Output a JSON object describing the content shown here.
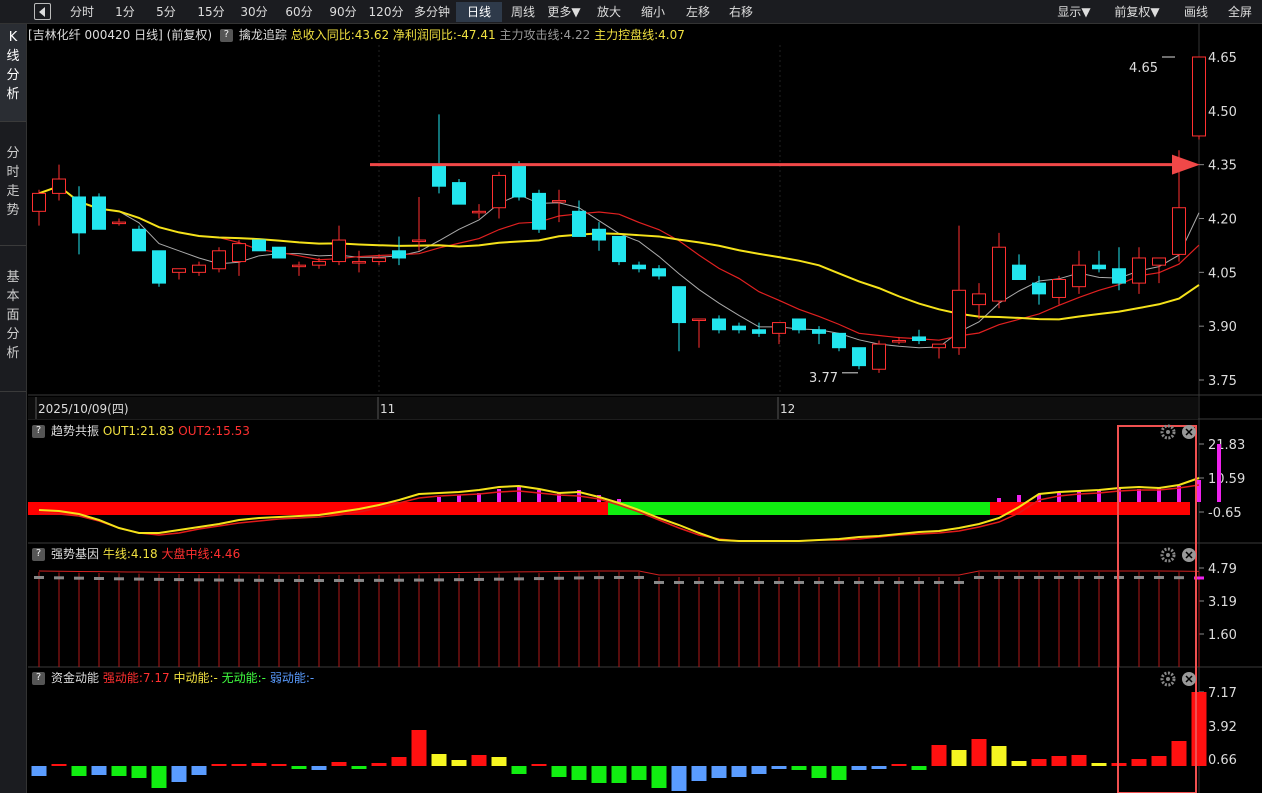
{
  "toolbar": {
    "buttons": [
      "分时",
      "1分",
      "5分",
      "15分",
      "30分",
      "60分",
      "90分",
      "120分",
      "多分钟",
      "日线",
      "周线",
      "更多▼",
      "放大",
      "缩小",
      "左移",
      "右移"
    ],
    "active": "日线",
    "right_buttons": [
      "显示▼",
      "前复权▼",
      "画线",
      "全屏"
    ]
  },
  "sidebar": {
    "tabs": [
      {
        "label": "K线分析",
        "chars": [
          "K",
          "线",
          "分",
          "析"
        ]
      },
      {
        "label": "分时走势",
        "chars": [
          "分",
          "时",
          "走",
          "势"
        ]
      },
      {
        "label": "基本面分析",
        "chars": [
          "基",
          "本",
          "面",
          "分",
          "析"
        ]
      }
    ]
  },
  "main_chart": {
    "stock": "[吉林化纤 000420 日线]",
    "adjust": "(前复权)",
    "indicator_name": "擒龙追踪",
    "revenue_label": "总收入同比:43.62",
    "profit_label": "净利润同比:-47.41",
    "attack_label": "主力攻击线:4.22",
    "control_label": "主力控盘线:4.07",
    "y_ticks": [
      "4.65",
      "4.50",
      "4.35",
      "4.20",
      "4.05",
      "3.90",
      "3.75"
    ],
    "high_label": "4.65",
    "low_label": "3.77",
    "date_labels": [
      "2025/10/09(四)",
      "11",
      "12"
    ],
    "colors": {
      "up": "#ff3030",
      "down": "#22e5ee",
      "ma_yellow": "#f5e21a",
      "ma_red": "#e02020",
      "ma_gray": "#aaaaaa",
      "arrow": "#f04848"
    }
  },
  "panel1": {
    "name": "趋势共振",
    "out1": "OUT1:21.83",
    "out2": "OUT2:15.53",
    "y_ticks": [
      "21.83",
      "10.59",
      "-0.65"
    ]
  },
  "panel2": {
    "name": "强势基因",
    "bull": "牛线:4.18",
    "market": "大盘中线:4.46",
    "y_ticks": [
      "4.79",
      "3.19",
      "1.60"
    ]
  },
  "panel3": {
    "name": "资金动能",
    "strong": "强动能:7.17",
    "mid": "中动能:-",
    "none": "无动能:-",
    "weak": "弱动能:-",
    "y_ticks": [
      "7.17",
      "3.92",
      "0.66"
    ]
  },
  "chart_data": {
    "type": "candlestick",
    "series_ohlc": [
      [
        4.22,
        4.28,
        4.18,
        4.27
      ],
      [
        4.27,
        4.35,
        4.25,
        4.31
      ],
      [
        4.26,
        4.29,
        4.1,
        4.16
      ],
      [
        4.26,
        4.27,
        4.17,
        4.17
      ],
      [
        4.19,
        4.2,
        4.18,
        4.19
      ],
      [
        4.17,
        4.18,
        4.11,
        4.11
      ],
      [
        4.11,
        4.11,
        4.01,
        4.02
      ],
      [
        4.05,
        4.06,
        4.03,
        4.06
      ],
      [
        4.05,
        4.08,
        4.04,
        4.07
      ],
      [
        4.06,
        4.12,
        4.05,
        4.11
      ],
      [
        4.08,
        4.14,
        4.04,
        4.13
      ],
      [
        4.14,
        4.14,
        4.11,
        4.11
      ],
      [
        4.12,
        4.12,
        4.09,
        4.09
      ],
      [
        4.07,
        4.08,
        4.04,
        4.07
      ],
      [
        4.07,
        4.09,
        4.06,
        4.08
      ],
      [
        4.08,
        4.18,
        4.07,
        4.14
      ],
      [
        4.08,
        4.11,
        4.05,
        4.08
      ],
      [
        4.08,
        4.1,
        4.07,
        4.09
      ],
      [
        4.11,
        4.15,
        4.07,
        4.09
      ],
      [
        4.14,
        4.26,
        4.11,
        4.14
      ],
      [
        4.35,
        4.49,
        4.27,
        4.29
      ],
      [
        4.3,
        4.31,
        4.24,
        4.24
      ],
      [
        4.22,
        4.24,
        4.2,
        4.22
      ],
      [
        4.23,
        4.33,
        4.2,
        4.32
      ],
      [
        4.35,
        4.36,
        4.25,
        4.26
      ],
      [
        4.27,
        4.28,
        4.16,
        4.17
      ],
      [
        4.25,
        4.28,
        4.19,
        4.25
      ],
      [
        4.22,
        4.25,
        4.15,
        4.15
      ],
      [
        4.17,
        4.19,
        4.11,
        4.14
      ],
      [
        4.15,
        4.15,
        4.07,
        4.08
      ],
      [
        4.07,
        4.08,
        4.05,
        4.06
      ],
      [
        4.06,
        4.07,
        4.03,
        4.04
      ],
      [
        4.01,
        4.01,
        3.83,
        3.91
      ],
      [
        3.92,
        3.92,
        3.84,
        3.92
      ],
      [
        3.92,
        3.93,
        3.88,
        3.89
      ],
      [
        3.9,
        3.91,
        3.88,
        3.89
      ],
      [
        3.89,
        3.91,
        3.87,
        3.88
      ],
      [
        3.88,
        3.91,
        3.85,
        3.91
      ],
      [
        3.92,
        3.92,
        3.88,
        3.89
      ],
      [
        3.89,
        3.9,
        3.85,
        3.88
      ],
      [
        3.88,
        3.88,
        3.83,
        3.84
      ],
      [
        3.84,
        3.84,
        3.78,
        3.79
      ],
      [
        3.78,
        3.86,
        3.77,
        3.85
      ],
      [
        3.86,
        3.87,
        3.85,
        3.86
      ],
      [
        3.87,
        3.89,
        3.85,
        3.86
      ],
      [
        3.84,
        3.85,
        3.81,
        3.85
      ],
      [
        3.84,
        4.18,
        3.82,
        4.0
      ],
      [
        3.96,
        4.02,
        3.92,
        3.99
      ],
      [
        3.97,
        4.16,
        3.95,
        4.12
      ],
      [
        4.07,
        4.1,
        4.03,
        4.03
      ],
      [
        4.02,
        4.04,
        3.96,
        3.99
      ],
      [
        3.98,
        4.04,
        3.96,
        4.03
      ],
      [
        4.01,
        4.11,
        3.99,
        4.07
      ],
      [
        4.07,
        4.11,
        4.05,
        4.06
      ],
      [
        4.06,
        4.12,
        4.0,
        4.02
      ],
      [
        4.02,
        4.12,
        3.99,
        4.09
      ],
      [
        4.07,
        4.09,
        4.02,
        4.09
      ],
      [
        4.1,
        4.39,
        4.08,
        4.23
      ],
      [
        4.43,
        4.65,
        4.42,
        4.65
      ]
    ],
    "ylim": [
      3.75,
      4.67
    ],
    "reference_line": 4.35
  }
}
